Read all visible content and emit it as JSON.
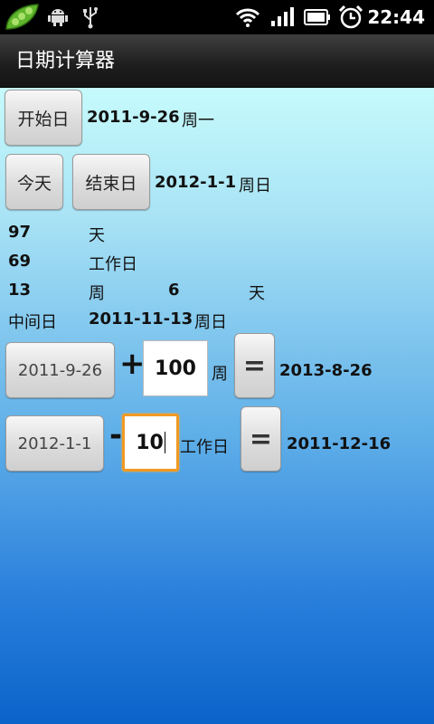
{
  "status_bar": {
    "time": "22:44",
    "icons": [
      "peapod-app-icon",
      "android-debug-icon",
      "usb-icon",
      "wifi-icon",
      "signal-icon",
      "battery-icon",
      "alarm-icon"
    ]
  },
  "title_bar": {
    "title": "日期计算器"
  },
  "start": {
    "button_label": "开始日",
    "date": "2011-9-26",
    "weekday": "周一"
  },
  "end": {
    "today_label": "今天",
    "button_label": "结束日",
    "date": "2012-1-1",
    "weekday": "周日"
  },
  "results": {
    "days_value": "97",
    "days_unit": "天",
    "workdays_value": "69",
    "workdays_unit": "工作日",
    "weeks_value": "13",
    "weeks_unit": "周",
    "extra_days_value": "6",
    "extra_days_unit": "天",
    "middle_label": "中间日",
    "middle_date": "2011-11-13",
    "middle_weekday": "周日"
  },
  "add_row": {
    "date_button": "2011-9-26",
    "operator": "+",
    "amount": "100",
    "unit": "周",
    "equals": "=",
    "result": "2013-8-26"
  },
  "sub_row": {
    "date_button": "2012-1-1",
    "operator": "-",
    "amount": "10",
    "unit": "工作日",
    "equals": "=",
    "result": "2011-12-16"
  },
  "colors": {
    "focus_border": "#f09a23",
    "bg_top": "#c6fbfc",
    "bg_bottom": "#0a63c9"
  }
}
